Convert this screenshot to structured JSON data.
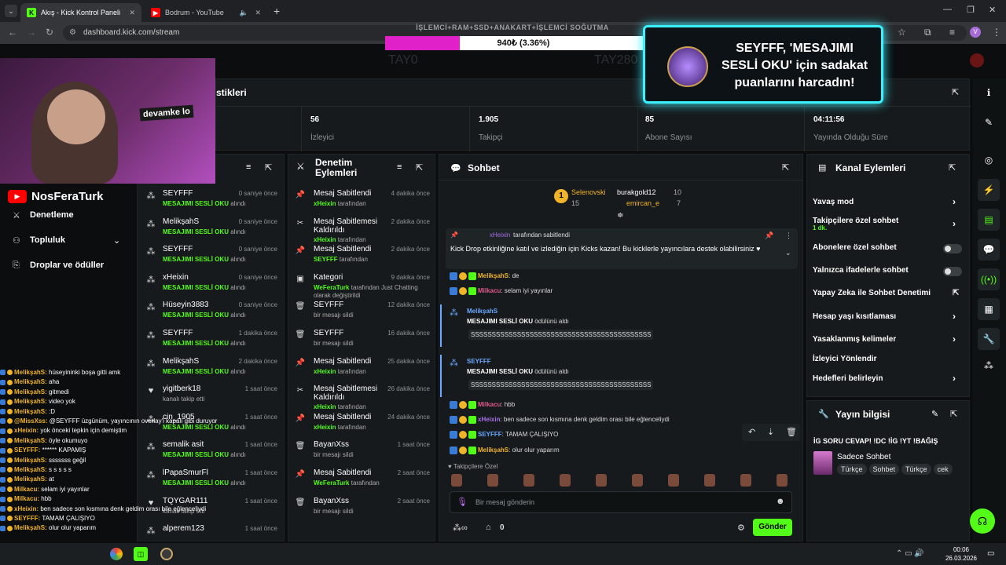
{
  "browser": {
    "tabs": [
      {
        "label": "Akış - Kick Kontrol Paneli"
      },
      {
        "label": "Bodrum - YouTube"
      }
    ],
    "url": "dashboard.kick.com/stream"
  },
  "overlay": {
    "top_text": "İŞLEMCİ+RAM+SSD+ANAKART+İŞLEMCİ SOĞUTMA",
    "progress_text": "940₺ (3.36%)",
    "progress": 0.0336,
    "left_faded": "TAY0",
    "right_faded": "TAY280",
    "reward_text": "SEYFFF, 'MESAJIMI SESLİ OKU' için sadakat puanlarını harcadın!",
    "reward_user": "SEYFFF",
    "cam_label": "devamke lo",
    "channel_name": "NosFeraTurk",
    "accent": "#53fc18"
  },
  "nav": {
    "items": [
      "Denetleme",
      "Topluluk",
      "Droplar ve ödüller"
    ]
  },
  "stats": {
    "title": "stikleri",
    "items": [
      {
        "num": "56",
        "lbl": "İzleyici"
      },
      {
        "num": "1.905",
        "lbl": "Takipçi"
      },
      {
        "num": "85",
        "lbl": "Abone Sayısı"
      },
      {
        "num": "04:11:56",
        "lbl": "Yayında Olduğu Süre"
      }
    ]
  },
  "activity": {
    "title": "şı",
    "rows": [
      {
        "name": "SEYFFF",
        "sub": "MESAJIMI SESLİ OKU",
        "sub2": " alındı",
        "time": "0 saniye önce",
        "icon": "reward"
      },
      {
        "name": "MelikşahS",
        "sub": "MESAJIMI SESLİ OKU",
        "sub2": " alındı",
        "time": "0 saniye önce",
        "icon": "reward"
      },
      {
        "name": "SEYFFF",
        "sub": "MESAJIMI SESLİ OKU",
        "sub2": " alındı",
        "time": "0 saniye önce",
        "icon": "reward"
      },
      {
        "name": "xHeixin",
        "sub": "MESAJIMI SESLİ OKU",
        "sub2": " alındı",
        "time": "0 saniye önce",
        "icon": "reward"
      },
      {
        "name": "Hüseyin3883",
        "sub": "MESAJIMI SESLİ OKU",
        "sub2": " alındı",
        "time": "0 saniye önce",
        "icon": "reward"
      },
      {
        "name": "SEYFFF",
        "sub": "MESAJIMI SESLİ OKU",
        "sub2": " alındı",
        "time": "1 dakika önce",
        "icon": "reward"
      },
      {
        "name": "MelikşahS",
        "sub": "MESAJIMI SESLİ OKU",
        "sub2": " alındı",
        "time": "2 dakika önce",
        "icon": "reward"
      },
      {
        "name": "yigitberk18",
        "sub": "",
        "sub2": "kanalı takip etti",
        "time": "1 saat önce",
        "icon": "heart"
      },
      {
        "name": "cin_1905",
        "sub": "MESAJIMI SESLİ OKU",
        "sub2": " alındı",
        "time": "1 saat önce",
        "icon": "reward"
      },
      {
        "name": "semalik asit",
        "sub": "MESAJIMI SESLİ OKU",
        "sub2": " alındı",
        "time": "1 saat önce",
        "icon": "reward"
      },
      {
        "name": "lPapaSmurFl",
        "sub": "MESAJIMI SESLİ OKU",
        "sub2": " alındı",
        "time": "1 saat önce",
        "icon": "reward"
      },
      {
        "name": "TQYGAR111",
        "sub": "",
        "sub2": "kanalı takip etti",
        "time": "1 saat önce",
        "icon": "heart"
      },
      {
        "name": "alperem123",
        "sub": "",
        "sub2": "",
        "time": "1 saat önce",
        "icon": "reward"
      }
    ]
  },
  "moderation": {
    "title": "Denetim Eylemleri",
    "rows": [
      {
        "name": "Mesaj Sabitlendi",
        "who": "xHeixin",
        "sub": " tarafından",
        "time": "4 dakika önce",
        "icon": "pin"
      },
      {
        "name": "Mesaj Sabitlemesi Kaldırıldı",
        "who": "xHeixin",
        "sub": " tarafından",
        "time": "2 dakika önce",
        "icon": "unpin"
      },
      {
        "name": "Mesaj Sabitlendi",
        "who": "SEYFFF",
        "sub": " tarafından",
        "time": "2 dakika önce",
        "icon": "pin"
      },
      {
        "name": "Kategori",
        "who": "WeFeraTurk",
        "sub": " tarafından Just Chatting olarak değiştirildi",
        "time": "9 dakika önce",
        "icon": "category"
      },
      {
        "name": "SEYFFF",
        "who": "",
        "sub": "bir mesajı sildi",
        "time": "12 dakika önce",
        "icon": "trash"
      },
      {
        "name": "SEYFFF",
        "who": "",
        "sub": "bir mesajı sildi",
        "time": "16 dakika önce",
        "icon": "trash"
      },
      {
        "name": "Mesaj Sabitlendi",
        "who": "xHeixin",
        "sub": " tarafından",
        "time": "25 dakika önce",
        "icon": "pin"
      },
      {
        "name": "Mesaj Sabitlemesi Kaldırıldı",
        "who": "xHeixin",
        "sub": " tarafından",
        "time": "26 dakika önce",
        "icon": "unpin"
      },
      {
        "name": "Mesaj Sabitlendi",
        "who": "xHeixin",
        "sub": " tarafından",
        "time": "24 dakika önce",
        "icon": "pin"
      },
      {
        "name": "BayanXss",
        "who": "",
        "sub": "bir mesajı sildi",
        "time": "1 saat önce",
        "icon": "trash"
      },
      {
        "name": "Mesaj Sabitlendi",
        "who": "WeFeraTurk",
        "sub": " tarafından",
        "time": "2 saat önce",
        "icon": "pin"
      },
      {
        "name": "BayanXss",
        "who": "",
        "sub": "bir mesajı sildi",
        "time": "2 saat önce",
        "icon": "trash"
      }
    ]
  },
  "chat": {
    "title": "Sohbet",
    "top_users": [
      {
        "name": "Selenovski",
        "count": "15"
      },
      {
        "name": "burakgold12",
        "count": "10"
      },
      {
        "name": "emircan_e",
        "count": "7"
      }
    ],
    "pinned_by": "xHeixin",
    "pinned_suffix": " tarafından sabitlendi",
    "pinned_text": "Kick Drop etkinliğine katıl ve izlediğin için Kicks kazan! Bu kicklerle yayıncılara destek olabilirsiniz ♥",
    "messages": [
      {
        "user": "MelikşahS",
        "text": ": de",
        "color": "#f0b429"
      },
      {
        "user": "Milkacu",
        "text": ": selam iyi yayınlar",
        "color": "#e05a8a"
      },
      {
        "user": "Milkacu",
        "text": ": hbb",
        "color": "#e05a8a"
      },
      {
        "user": "xHeixin",
        "text": ": ben sadece son kısmına denk geldim orası bile eğlenceliydi",
        "color": "#a86ee8"
      },
      {
        "user": "SEYFFF",
        "text": ": TAMAM ÇALIŞIYO",
        "color": "#6aa9ff"
      },
      {
        "user": "MelikşahS",
        "text": ": olur olur yaparım",
        "color": "#f0b429"
      }
    ],
    "rewards": [
      {
        "user": "MelikşahS",
        "reward": "MESAJIMI SESLİ OKU",
        "suffix": " ödülünü aldı",
        "msg": "SSSSSSSSSSSSSSSSSSSSSSSSSSSSSSSSSSSSSSSSSSS"
      },
      {
        "user": "SEYFFF",
        "reward": "MESAJIMI SESLİ OKU",
        "suffix": " ödülünü aldı",
        "msg": "SSSSSSSSSSSSSSSSSSSSSSSSSSSSSSSSSSSSSSSSSSS"
      }
    ],
    "followers_label": "Takipçilere Özel",
    "input_placeholder": "Bir mesaj gönderin",
    "count": "0",
    "send": "Gönder"
  },
  "channel_actions": {
    "title": "Kanal Eylemleri",
    "items": [
      {
        "label": "Yavaş mod",
        "sub": "",
        "ctl": "chev"
      },
      {
        "label": "Takipçilere özel sohbet",
        "sub": "1 dk.",
        "ctl": "chev"
      },
      {
        "label": "Abonelere özel sohbet",
        "sub": "",
        "ctl": "toggle"
      },
      {
        "label": "Yalnızca ifadelerle sohbet",
        "sub": "",
        "ctl": "toggle"
      },
      {
        "label": "Yapay Zeka ile Sohbet Denetimi",
        "sub": "",
        "ctl": "ext"
      },
      {
        "label": "Hesap yaşı kısıtlaması",
        "sub": "",
        "ctl": "chev"
      },
      {
        "label": "Yasaklanmış kelimeler",
        "sub": "",
        "ctl": "chev"
      },
      {
        "label": "İzleyici Yönlendir",
        "sub": "",
        "ctl": "none"
      },
      {
        "label": "Hedefleri belirleyin",
        "sub": "",
        "ctl": "chev"
      }
    ]
  },
  "stream_info": {
    "title": "Yayın bilgisi",
    "stream_title": "İG SORU CEVAP! !DC !İG !YT !BAĞIŞ",
    "category": "Sadece Sohbet",
    "tags": [
      "Türkçe",
      "Sohbet",
      "Türkçe",
      "cek"
    ]
  },
  "overlay_chat": [
    {
      "user": "",
      "text": "hüseyininki boşa gitti amk",
      "prefix": "MelikşahS:"
    },
    {
      "user": "",
      "text": "aha",
      "prefix": "MelikşahS:"
    },
    {
      "user": "",
      "text": "gitmedi",
      "prefix": "MelikşahS:"
    },
    {
      "user": "",
      "text": "video yok",
      "prefix": "MelikşahS:"
    },
    {
      "user": "",
      "text": ":D",
      "prefix": "MelikşahS:"
    },
    {
      "user": "",
      "text": "@SEYFFF üzgünüm, yayıncının overlay'i kapalı gibi duruyor",
      "prefix": "@MissXss:"
    },
    {
      "user": "",
      "text": "yok önceki tepkin için demiştim",
      "prefix": "xHeixin:"
    },
    {
      "user": "",
      "text": "öyle okumuyo",
      "prefix": "MelikşahS:"
    },
    {
      "user": "",
      "text": "****** KAPAMIŞ",
      "prefix": "SEYFFF:"
    },
    {
      "user": "",
      "text": "sssssss geğil",
      "prefix": "MelikşahS:"
    },
    {
      "user": "",
      "text": "s s s s s",
      "prefix": "MelikşahS:"
    },
    {
      "user": "",
      "text": "at",
      "prefix": "MelikşahS:"
    },
    {
      "user": "",
      "text": "selam iyi yayınlar",
      "prefix": "Milkacu:"
    },
    {
      "user": "",
      "text": "hbb",
      "prefix": "Milkacu:"
    },
    {
      "user": "",
      "text": "ben sadece son kısmına denk geldim orası bile eğlenceliydi",
      "prefix": "xHeixin:"
    },
    {
      "user": "",
      "text": "TAMAM ÇALIŞIYO",
      "prefix": "SEYFFF:"
    },
    {
      "user": "",
      "text": "olur olur yaparım",
      "prefix": "MelikşahS:"
    }
  ],
  "taskbar": {
    "time": "00:06",
    "date": "26.03.2026"
  }
}
